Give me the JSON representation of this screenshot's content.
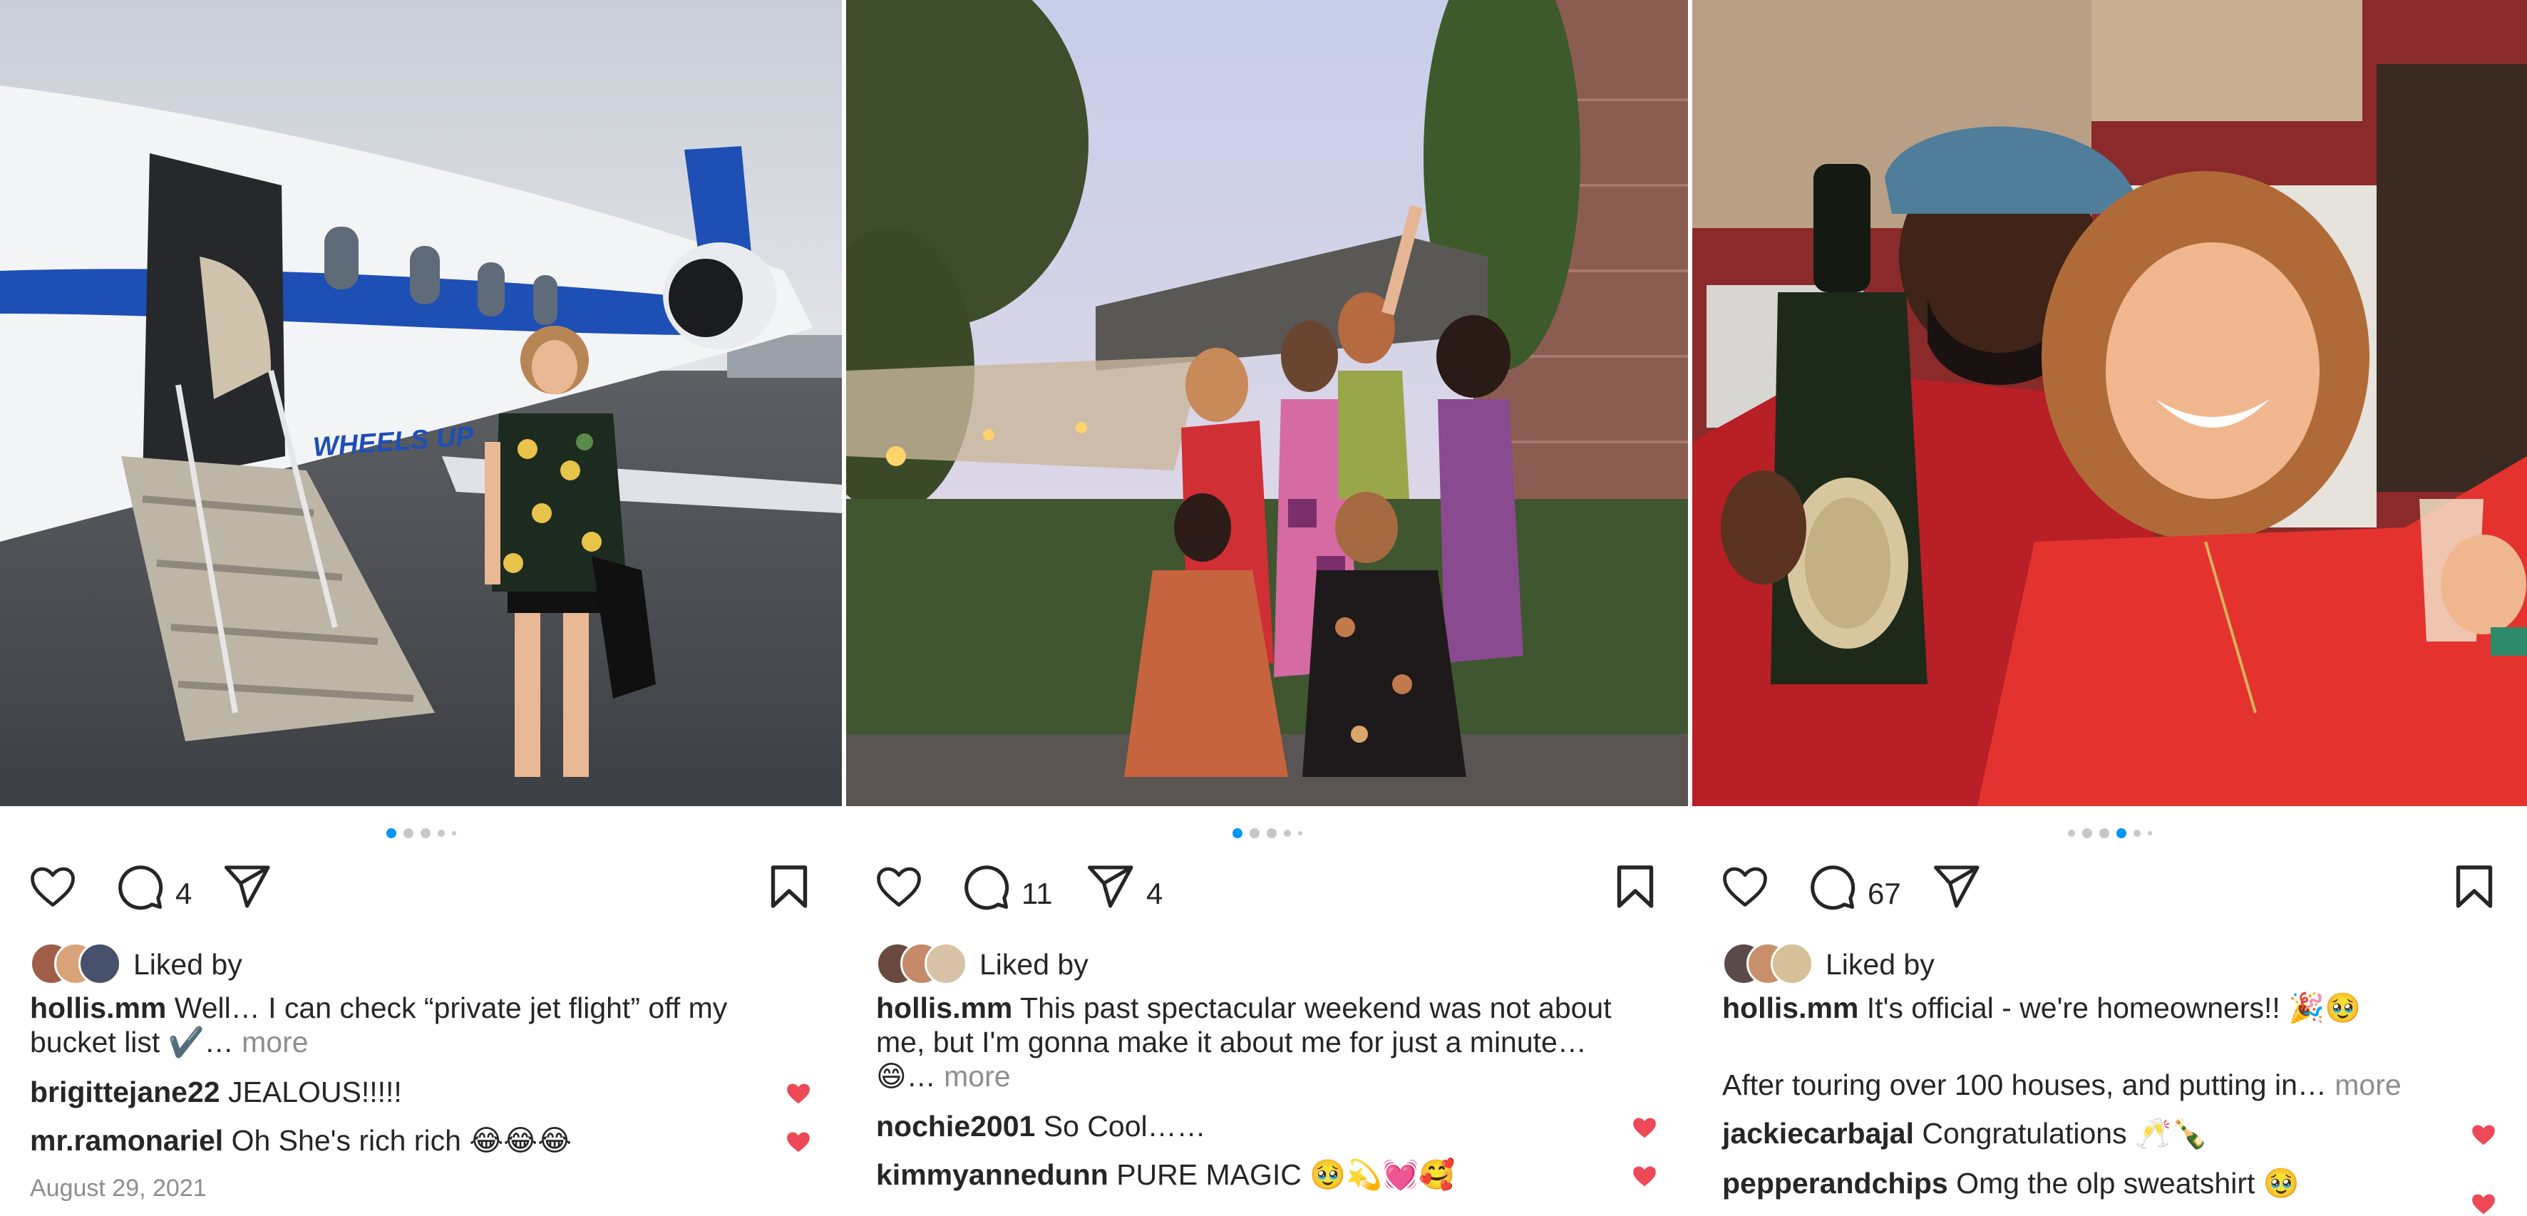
{
  "posts": [
    {
      "comment_count": "4",
      "share_count": "",
      "liked_by": "Liked by",
      "caption": {
        "username": "hollis.mm",
        "text": "Well… I can check “private jet flight” off my bucket list ✔️…",
        "more": "more"
      },
      "comments": [
        {
          "username": "brigittejane22",
          "text": "JEALOUS!!!!!"
        },
        {
          "username": "mr.ramonariel",
          "text": "Oh She's rich rich 😂😂😂"
        }
      ],
      "date": "August 29, 2021",
      "photo_text": "WHEELS UP",
      "active_dot": 0
    },
    {
      "comment_count": "11",
      "share_count": "4",
      "liked_by": "Liked by",
      "caption": {
        "username": "hollis.mm",
        "text": "This past spectacular weekend was not about me, but I'm gonna make it about me for just a minute… 😄…",
        "more": "more"
      },
      "comments": [
        {
          "username": "nochie2001",
          "text": "So Cool……"
        },
        {
          "username": "kimmyannedunn",
          "text": "PURE MAGIC 🥹💫💓🥰"
        }
      ],
      "active_dot": 0
    },
    {
      "comment_count": "67",
      "share_count": "",
      "liked_by": "Liked by",
      "caption": {
        "username": "hollis.mm",
        "text": "It's official - we're homeowners!! 🎉🥹",
        "text2": "After touring over 100 houses, and putting in…",
        "more": "more"
      },
      "comments": [
        {
          "username": "jackiecarbajal",
          "text": "Congratulations 🥂🍾"
        },
        {
          "username": "pepperandchips",
          "text": "Omg the olp sweatshirt 🥹"
        }
      ],
      "active_dot": 3
    }
  ],
  "icons": {
    "like": "heart-outline-icon",
    "comment": "comment-bubble-icon",
    "share": "paper-plane-icon",
    "save": "bookmark-icon",
    "comment_like": "heart-filled-icon"
  },
  "colors": {
    "heart": "#ed4956",
    "dot_active": "#0095f6",
    "dot_inactive": "#c7c7c7",
    "muted_text": "#8e8e8e"
  }
}
